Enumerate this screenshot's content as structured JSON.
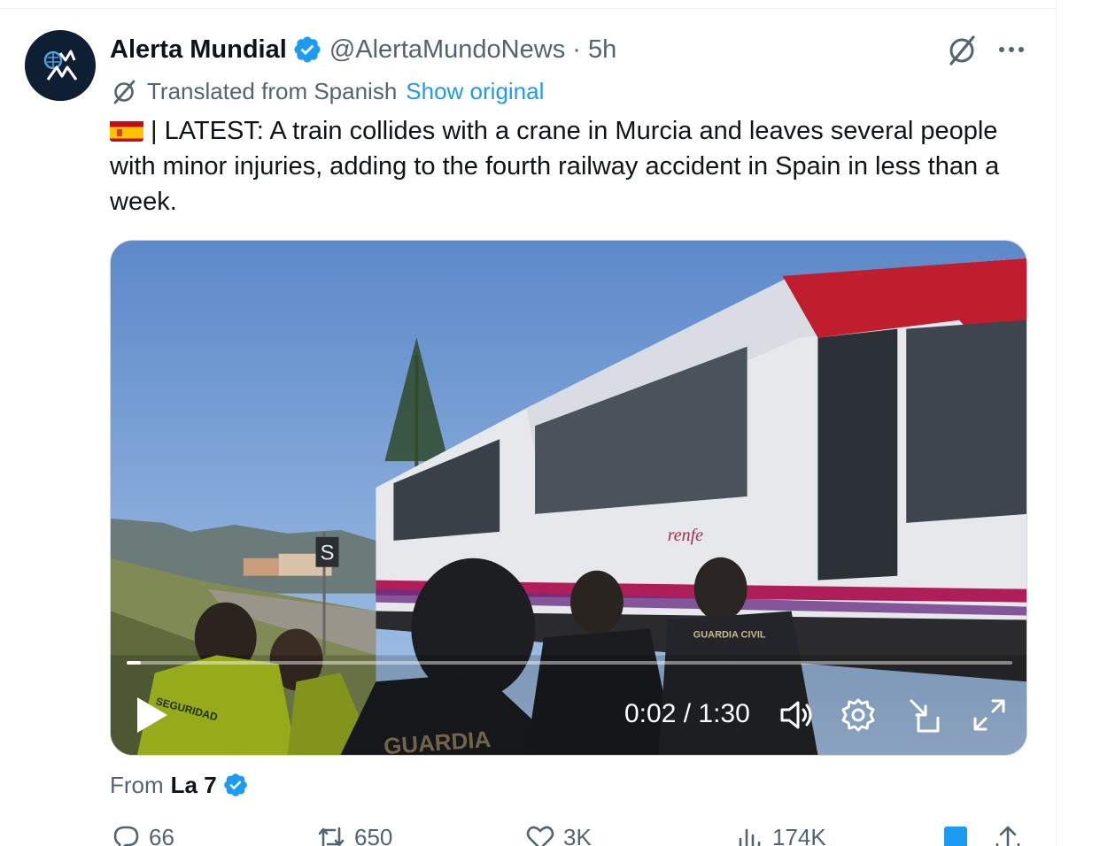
{
  "tweet": {
    "author": {
      "display_name": "Alerta Mundial",
      "handle_time": "@AlertaMundoNews · 5h",
      "verified": true
    },
    "translation": {
      "label": "Translated from Spanish",
      "action": "Show original"
    },
    "text": "| LATEST: A train collides with a crane in Murcia and leaves several people with minor injuries, adding to the fourth railway accident in Spain in less than a week.",
    "media": {
      "time_display": "0:02 / 1:30",
      "progress_fraction": 0.016,
      "scene_texts": {
        "signal": "S",
        "brand": "renfe",
        "vest_back": "GUARDIA CIVIL",
        "vest_front": "SEGURIDAD",
        "jacket": "GUARDIA"
      }
    },
    "source": {
      "label": "From",
      "name": "La 7",
      "verified": true
    },
    "actions": {
      "replies": "66",
      "reposts": "650",
      "likes": "3K",
      "views": "174K"
    }
  },
  "colors": {
    "accent": "#1d9bf0",
    "secondary_text": "#536471",
    "primary_text": "#0f1419"
  },
  "icons": [
    "grok-icon",
    "more-icon",
    "verified-icon",
    "translate-icon",
    "flag-spain-icon",
    "play-icon",
    "volume-icon",
    "settings-icon",
    "pip-icon",
    "fullscreen-icon",
    "reply-icon",
    "repost-icon",
    "like-icon",
    "views-icon",
    "bookmark-icon",
    "share-icon"
  ]
}
